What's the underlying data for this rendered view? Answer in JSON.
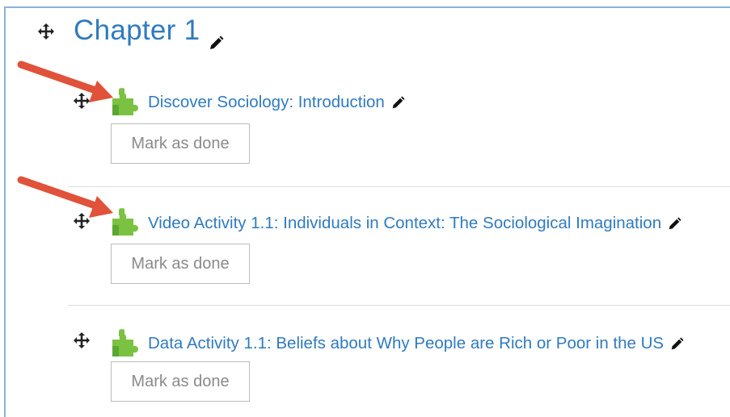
{
  "section": {
    "title": "Chapter 1"
  },
  "activities": [
    {
      "name": "Discover Sociology: Introduction",
      "button": "Mark as done",
      "icon": "puzzle-piece-icon"
    },
    {
      "name": "Video Activity 1.1: Individuals in Context: The Sociological Imagination",
      "button": "Mark as done",
      "icon": "puzzle-piece-icon"
    },
    {
      "name": "Data Activity 1.1: Beliefs about Why People are Rich or Poor in the US",
      "button": "Mark as done",
      "icon": "puzzle-piece-icon"
    }
  ],
  "colors": {
    "link": "#2f7bbf",
    "frame_border": "#8bb3d9",
    "arrow": "#e0523a",
    "puzzle": "#7cc242",
    "button_text": "#8a8a8a",
    "button_border": "#bdbdbd"
  }
}
